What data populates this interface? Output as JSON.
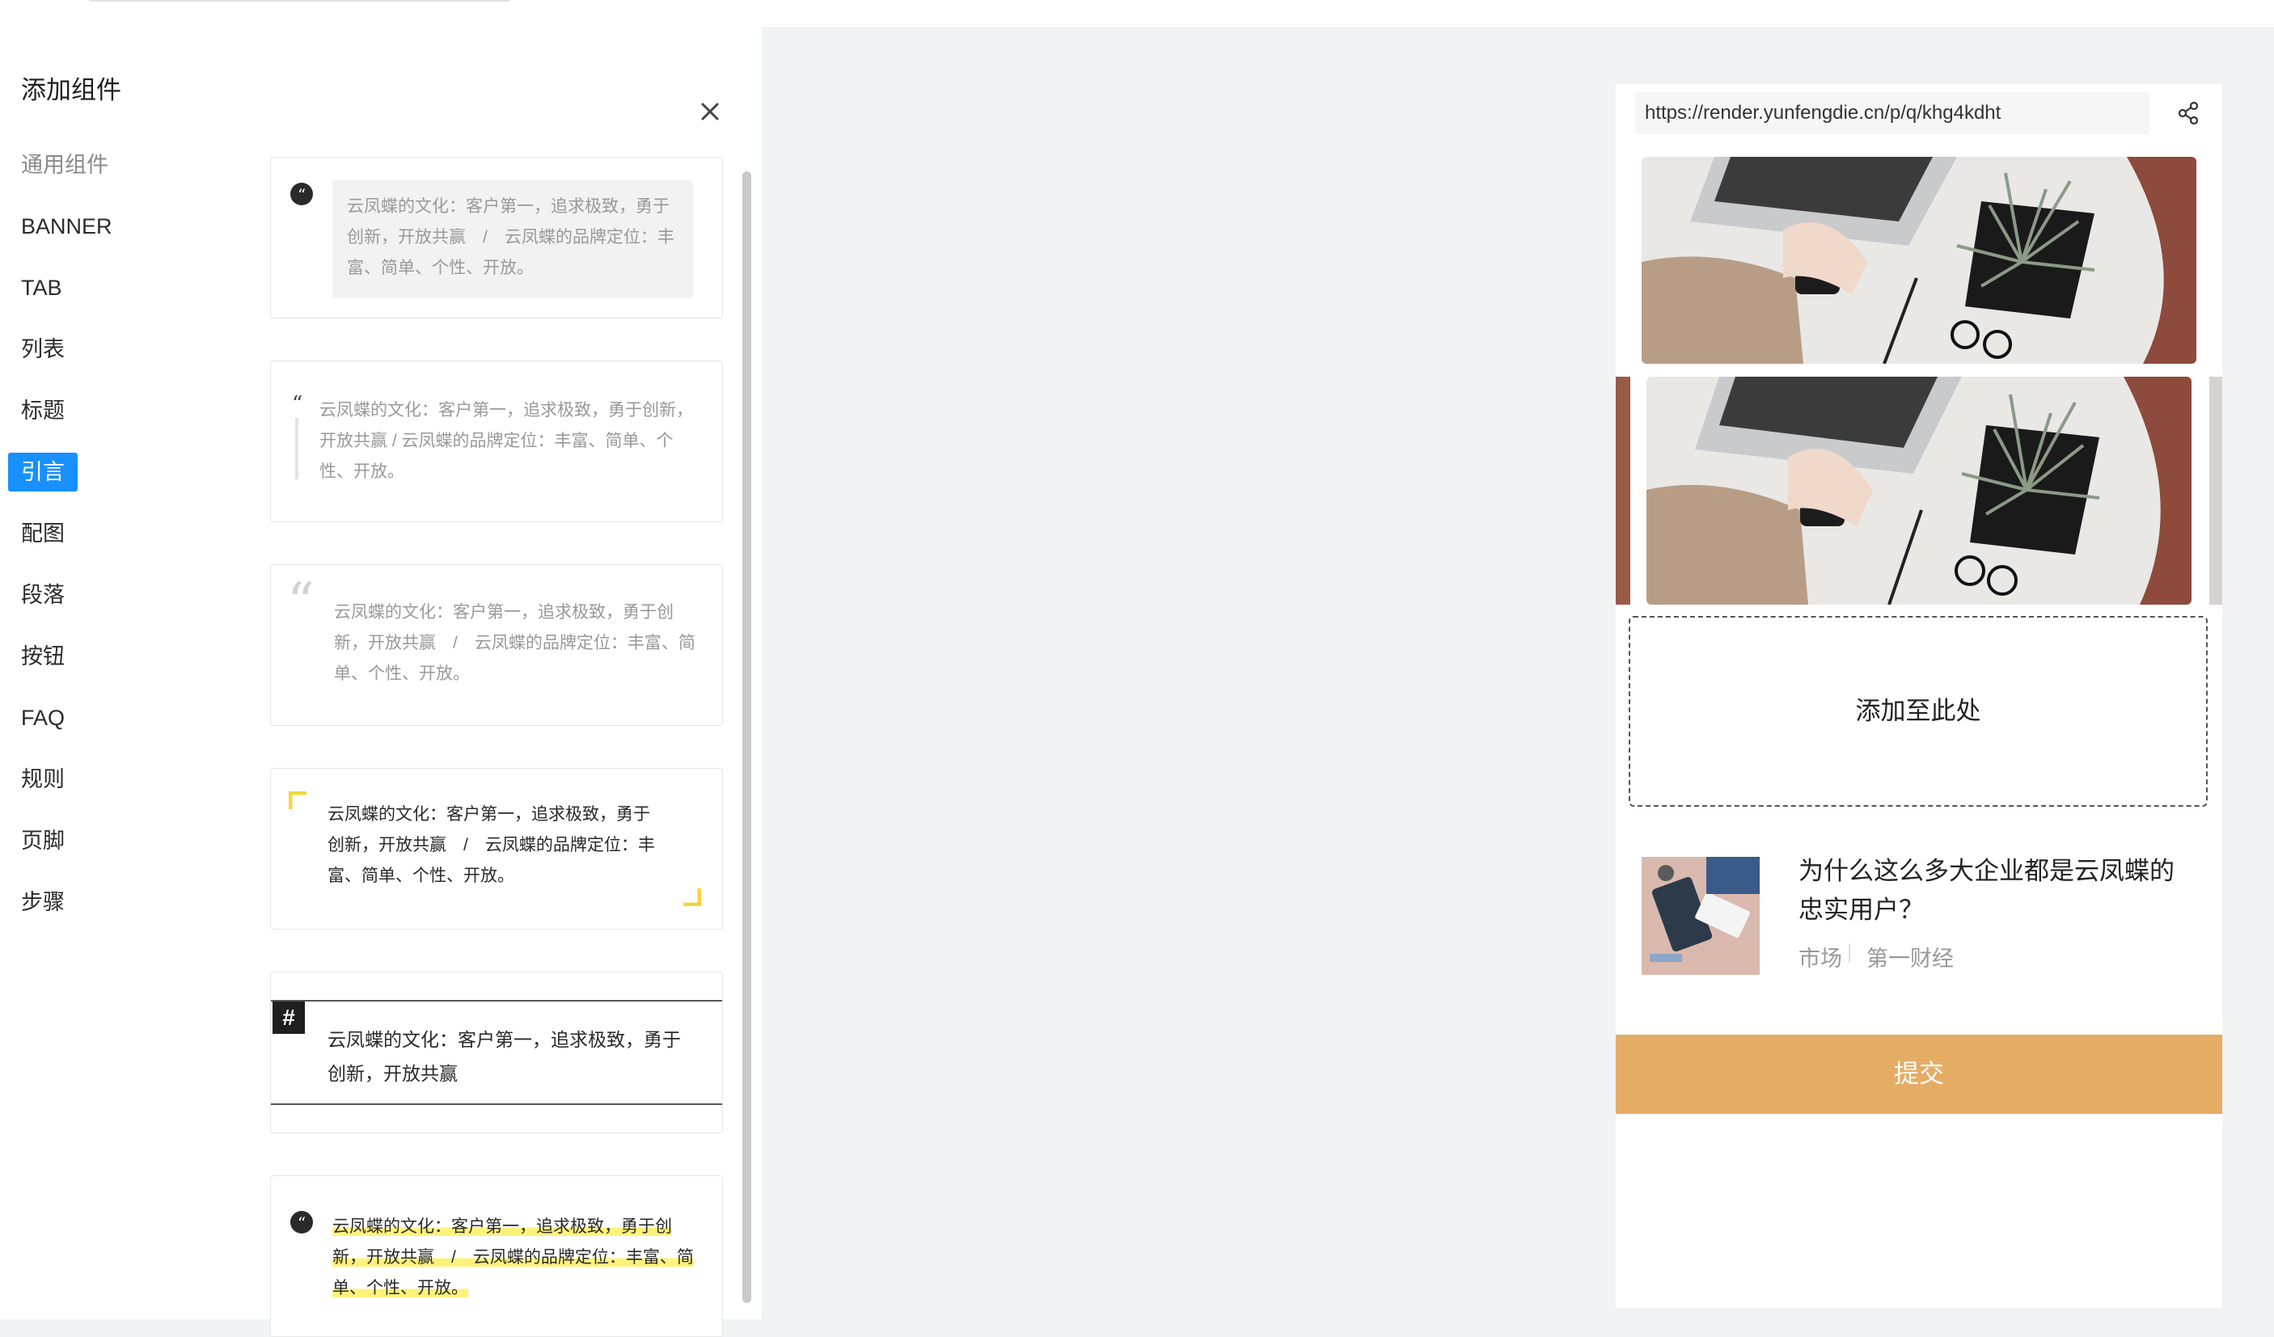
{
  "panel": {
    "title": "添加组件",
    "categories": [
      {
        "label": "通用组件"
      },
      {
        "label": "BANNER"
      },
      {
        "label": "TAB"
      },
      {
        "label": "列表"
      },
      {
        "label": "标题"
      },
      {
        "label": "引言"
      },
      {
        "label": "配图"
      },
      {
        "label": "段落"
      },
      {
        "label": "按钮"
      },
      {
        "label": "FAQ"
      },
      {
        "label": "规则"
      },
      {
        "label": "页脚"
      },
      {
        "label": "步骤"
      }
    ],
    "active_category": "引言"
  },
  "quotes": {
    "q1": {
      "l1": "云凤蝶的文化：客户第一，追求极致，勇于",
      "l2": "创新，开放共赢　/　云凤蝶的品牌定位：丰",
      "l3": "富、简单、个性、开放。"
    },
    "q2": {
      "l1": "云凤蝶的文化：客户第一，追求极致，勇于创新，",
      "l2": "开放共赢 / 云凤蝶的品牌定位：丰富、简单、个",
      "l3": "性、开放。"
    },
    "q3": {
      "l1": "云凤蝶的文化：客户第一，追求极致，勇于创",
      "l2": "新，开放共赢　/　云凤蝶的品牌定位：丰富、简",
      "l3": "单、个性、开放。"
    },
    "q4": {
      "l1": "云凤蝶的文化：客户第一，追求极致，勇于",
      "l2": "创新，开放共赢　/　云凤蝶的品牌定位：丰",
      "l3": "富、简单、个性、开放。"
    },
    "q5": {
      "hash": "#",
      "l1": "云凤蝶的文化：客户第一，追求极致，勇于",
      "l2": "创新，开放共赢"
    },
    "q6": {
      "l1": "云凤蝶的文化：客户第一，追求极致，勇于创",
      "l2": "新，开放共赢　/　云凤蝶的品牌定位：丰富、简",
      "l3": "单、个性、开放。"
    }
  },
  "preview": {
    "url": "https://render.yunfengdie.cn/p/q/khg4kdht",
    "dropzone_label": "添加至此处",
    "news": {
      "title_line1": "为什么这么多大企业都是云凤蝶的",
      "title_line2": "忠实用户？",
      "tag1": "市场",
      "separator": "|",
      "tag2": "第一财经"
    },
    "submit_label": "提交"
  },
  "colors": {
    "accent": "#1890ff",
    "submit": "#e5ac63",
    "highlight": "#fff27a",
    "corner": "#f5d53c"
  },
  "icons": [
    "close-icon",
    "share-icon",
    "quote-icon",
    "hash-icon"
  ]
}
